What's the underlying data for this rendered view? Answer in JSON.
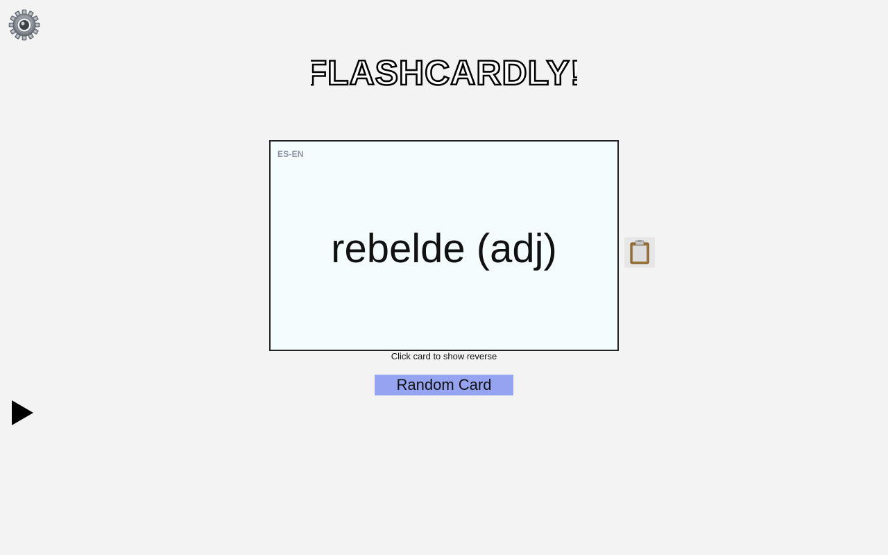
{
  "app": {
    "logo_text": "FLASHCARDLY!"
  },
  "card": {
    "language_pair": "ES-EN",
    "word": "rebelde (adj)"
  },
  "hint": "Click card to show reverse",
  "buttons": {
    "random_card": "Random Card"
  },
  "icons": {
    "settings": "gear-icon",
    "clipboard": "clipboard-icon",
    "play": "play-icon"
  },
  "colors": {
    "background": "#f3f3f3",
    "card_background": "#f4fcfd",
    "button_accent": "#95a3f0",
    "language_label": "#8a93a6"
  }
}
